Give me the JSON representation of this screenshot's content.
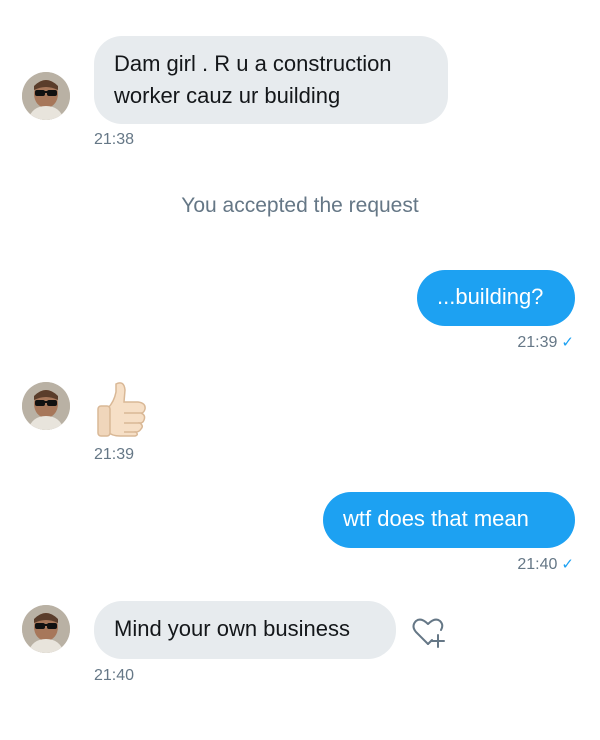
{
  "system": {
    "accepted_text": "You accepted the request"
  },
  "messages": [
    {
      "from": "them",
      "kind": "text",
      "text": "Dam girl . R u a construction worker cauz ur building",
      "line1": "Dam girl . R u a construction",
      "line2": "worker cauz ur building",
      "time": "21:38"
    },
    {
      "from": "me",
      "kind": "text",
      "text": "...building?",
      "time": "21:39",
      "read_check": "✓"
    },
    {
      "from": "them",
      "kind": "emoji",
      "emoji_name": "thumbs-up-light-skin",
      "time": "21:39"
    },
    {
      "from": "me",
      "kind": "text",
      "text": "wtf does that mean",
      "time": "21:40",
      "read_check": "✓"
    },
    {
      "from": "them",
      "kind": "text",
      "text": "Mind your own business",
      "time": "21:40"
    }
  ],
  "icons": {
    "avatar": "user-avatar",
    "like": "heart-plus-icon",
    "read": "checkmark-icon"
  },
  "colors": {
    "outgoing_bubble": "#1da1f2",
    "incoming_bubble": "#e7ebee",
    "timestamp": "#657786",
    "check": "#1da1f2"
  }
}
